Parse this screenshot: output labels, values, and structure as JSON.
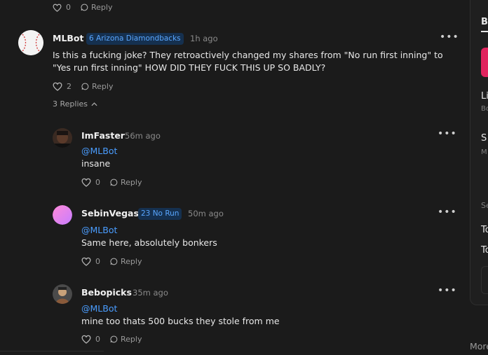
{
  "top_actions": {
    "likes": "0",
    "reply_label": "Reply"
  },
  "main_comment": {
    "username": "MLBot",
    "badge": "6 Arizona Diamondbacks",
    "time": "1h ago",
    "text": "Is this a fucking joke? They retroactively changed my shares from \"No run first inning\" to \"Yes run first inning\" HOW DID THEY FUCK THIS UP SO BADLY?",
    "likes": "2",
    "reply_label": "Reply",
    "replies_toggle": "3 Replies"
  },
  "replies": [
    {
      "username": "ImFaster",
      "badge": "",
      "time": "56m ago",
      "mention": "@MLBot",
      "text": "insane",
      "likes": "0",
      "reply_label": "Reply"
    },
    {
      "username": "SebinVegas",
      "badge": "23 No Run",
      "time": "50m ago",
      "mention": "@MLBot",
      "text": "Same here, absolutely bonkers",
      "likes": "0",
      "reply_label": "Reply"
    },
    {
      "username": "Bebopicks",
      "badge": "",
      "time": "35m ago",
      "mention": "@MLBot",
      "text": "mine too thats 500 bucks they stole from me",
      "likes": "0",
      "reply_label": "Reply"
    }
  ],
  "right_panel": {
    "tab": "B",
    "item1_title": "Li",
    "item1_sub": "Bo",
    "item2_title": "S",
    "item2_sub": "M",
    "section_label": "Se",
    "row1": "To",
    "row2": "To",
    "footer": "More"
  },
  "colors": {
    "background": "#1b1b1b",
    "mention": "#4a9dff",
    "badge_text": "#5aa7ff",
    "badge_bg": "#15304f",
    "accent_pink": "#e0245e"
  },
  "icons": [
    "heart-icon",
    "comment-icon",
    "more-icon",
    "chevron-up-icon",
    "baseball-avatar"
  ]
}
